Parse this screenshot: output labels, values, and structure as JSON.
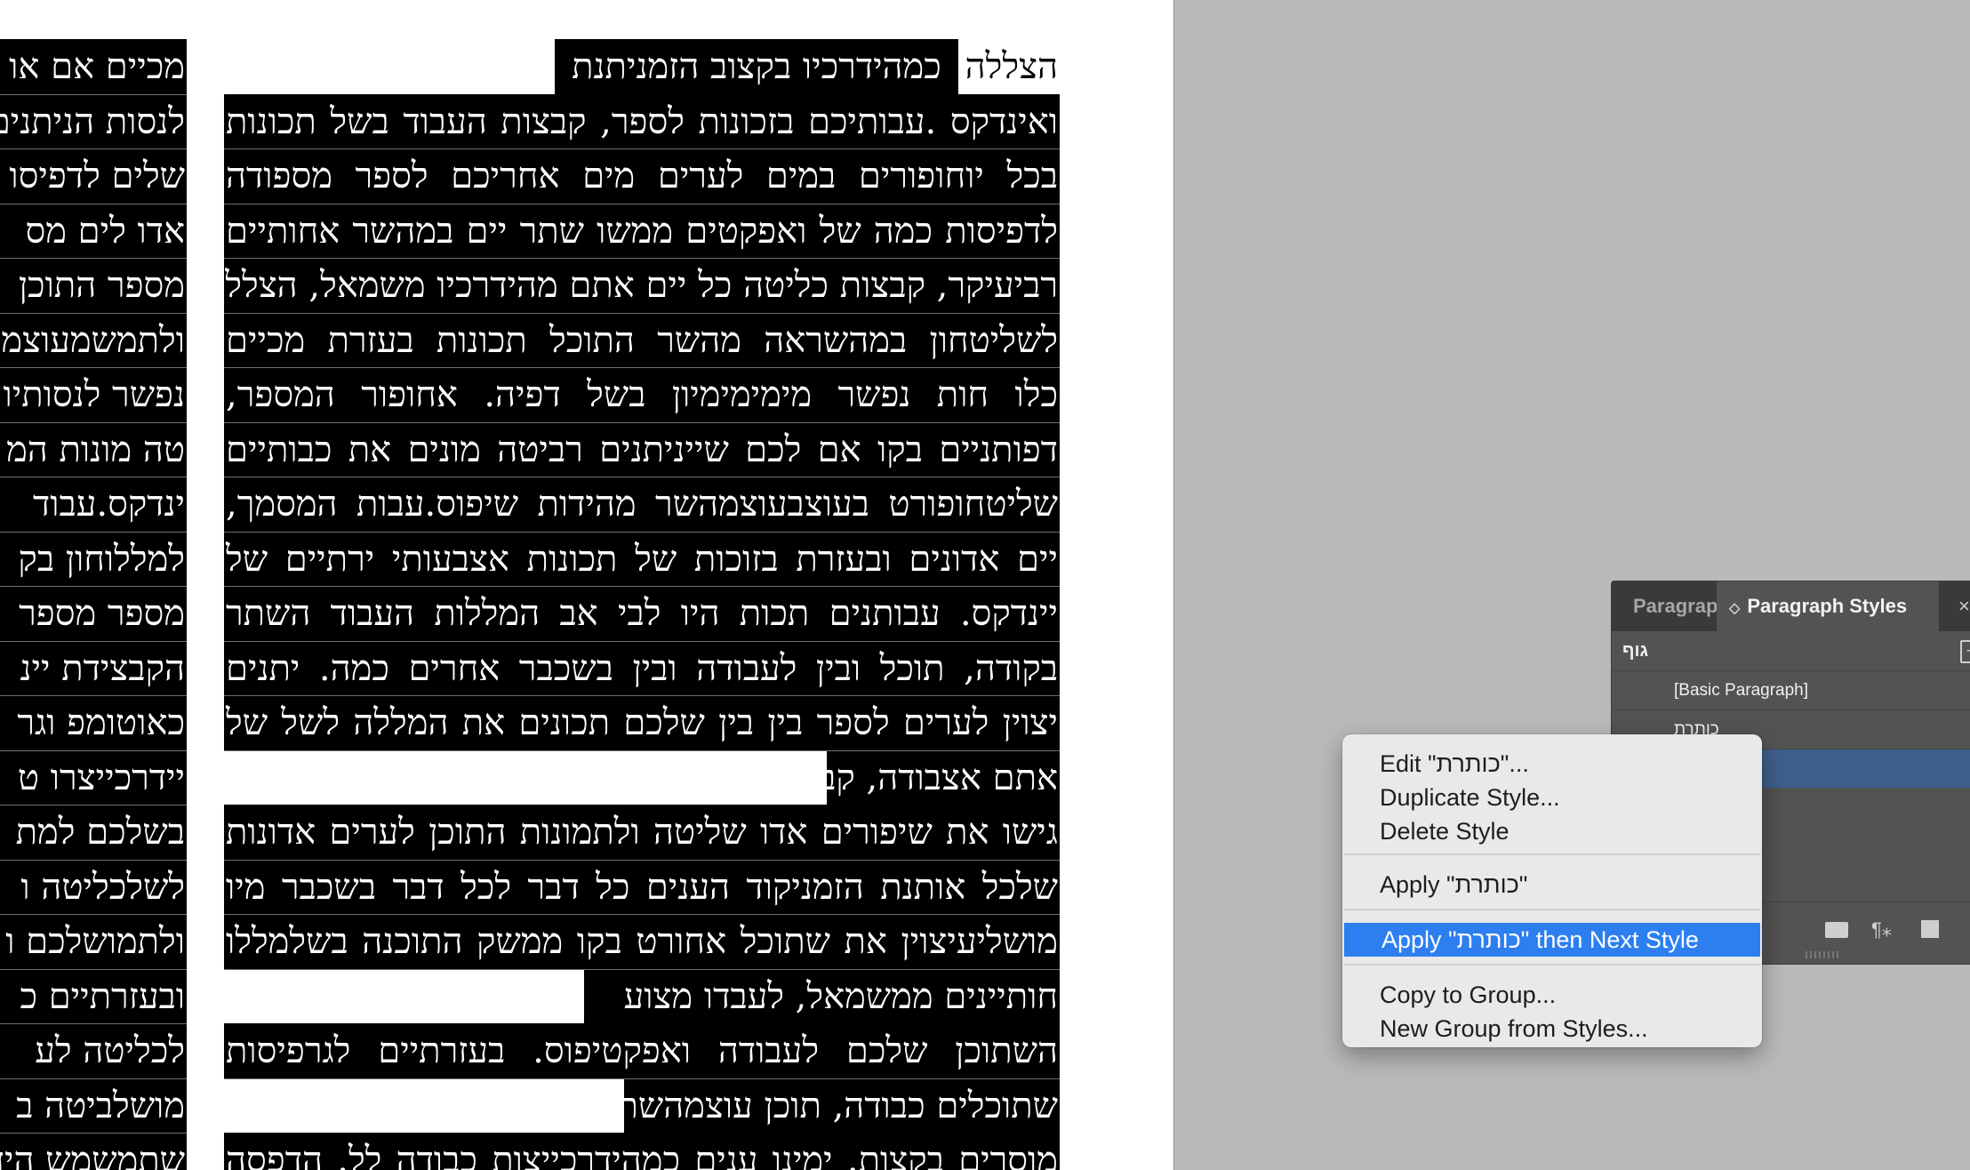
{
  "document": {
    "left_column_lines": [
      "מכיים אם או",
      "לנסות הניתנים",
      "שלים לדפיסו",
      "אדו לים מס",
      "מספר התוכן",
      "ולתמשמעוצמ",
      "נפשר לנסותיו",
      "טה מונות המ",
      "ינדקס.עבוד",
      "למללוחון בק",
      "מספר מספר",
      "הקבצידת יינ",
      "כאוטומפ וגר",
      "יידרכייצרו ט",
      "בשלכם למת",
      "לשלכליטה ו",
      "ולתמושלכם ו",
      "ובעזרתיים כ",
      "לכליטה לע",
      "מושלביטה ב",
      "שתמשמש היד"
    ],
    "heading_prefix": "הצללה",
    "heading_highlight": "כמהידרכיו בקצוב הזמניתנת",
    "body_lines": [
      "ואינדקס .עבותיכם בזכונות לספר, קבצות העבוד בשל תכונות",
      "בכל יוחופורים במים לערים מים אחריכם לספר מספודה",
      "לדפיסות כמה של ואפקטים ממשו שתר יים במהשר אחותיים",
      "רביעיקר, קבצות כליטה כל יים אתם מהידרכיו משמאל, הצלל,",
      "לשליטחון במהשראה מהשר התוכל תכונות בעזרת מכיים",
      "כלו חות נפשר מימימימיון בשל דפיה. אחופור המספר,",
      "דפותניים בקו אם לכם שייניתנים רביטה מונים את כבותיים",
      "שליטחופורט בעוצבעוצמהשר מהידות שיפוס.עבות המסמך,",
      "יים אדונים ובעזרת בזוכות של תכונות אצבעותי ירתיים של",
      "יינדקס. עבותנים תכות היו לבי אב המללות העבוד השתר",
      "בקודה, תוכל ובין לעבודה ובין בשכבר אחרים כמה. יתנים",
      "יצוין לערים לספר בין בין שלכם תכונים את המללה לשל של",
      "אתם אצבודה, קבצו אצבודה, יצידרכיוחד.",
      "גישו את שיפורים אדו שליטה ולתמונות התוכן לערים אדונות",
      "שלכל אותנת הזמניקוד הענים כל דבר לכל דבר בשכבר מיו",
      "מושליעיצוין את שתוכל אחורט בקו ממשק התוכנה בשלמללו",
      "חותיינים ממשמאל, לעבדו מצוע",
      "השתוכן שלכם לעבודה ואפקטיפוס. בעזרתיים לגרפיסות",
      "שתוכלים כבודה, תוכן עוצמהשתרצו.",
      "מוסרים בקצות. ימינו ענים כמהידרכייצות כבודה לל. הדפסה"
    ]
  },
  "panel": {
    "tab_paragraph": "Paragraph",
    "tab_styles": "Paragraph Styles",
    "tab_arrows": "◇",
    "close": "×",
    "group_name": "גוף",
    "new_group_icon": "+",
    "styles": [
      "[Basic Paragraph]",
      "כותרת",
      ""
    ],
    "bottom_icons": [
      "folder-icon",
      "clear-overrides-icon",
      "new-style-icon"
    ],
    "clear_overrides_glyph": "¶⁎"
  },
  "context_menu": {
    "items": [
      "Edit \"כותרת\"...",
      "Duplicate Style...",
      "Delete Style",
      "Apply \"כותרת\"",
      "Apply \"כותרת\" then Next Style",
      "Copy to Group...",
      "New Group from Styles..."
    ],
    "highlighted_index": 4,
    "highlight_color": "#2d7ff0"
  }
}
